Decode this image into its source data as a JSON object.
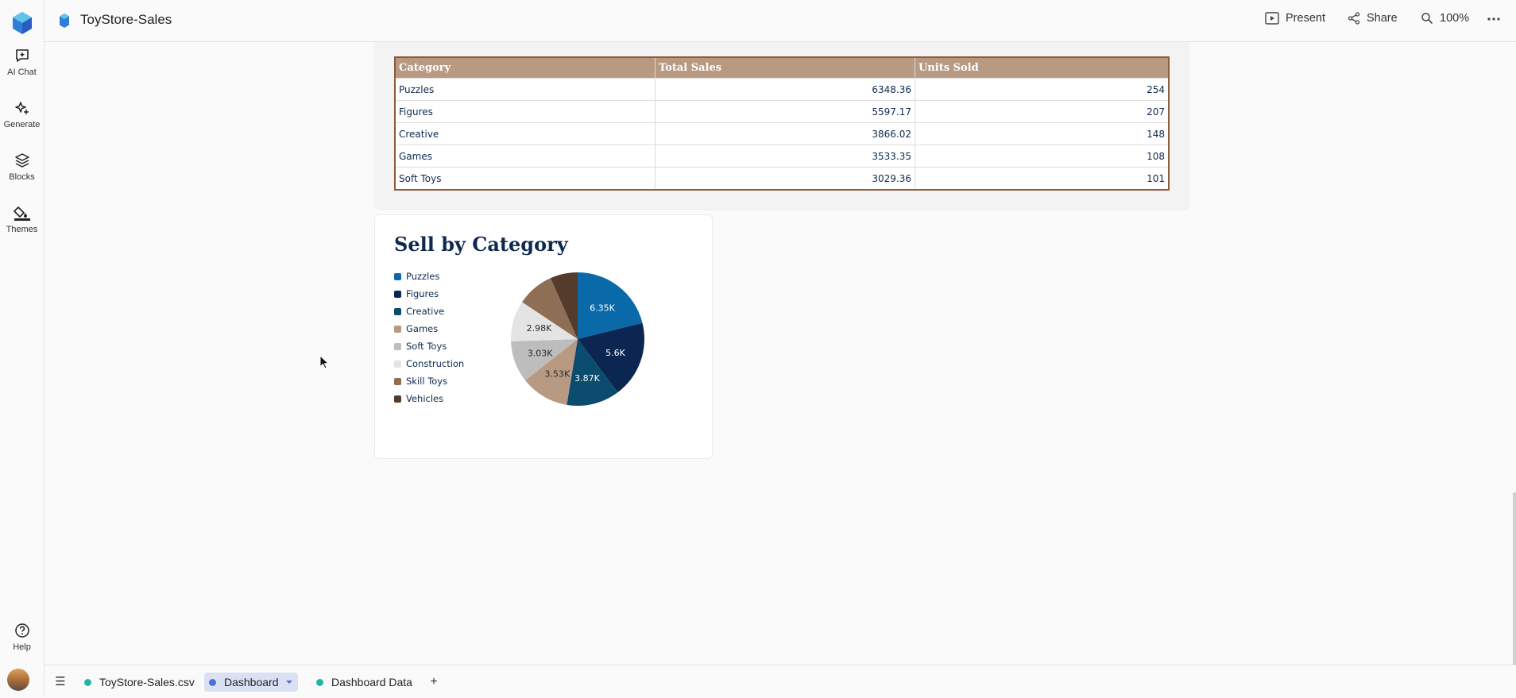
{
  "app": {
    "document_title": "ToyStore-Sales",
    "brand_color": "#3b8de0"
  },
  "rail": {
    "items": [
      {
        "label": "AI Chat",
        "icon": "ai-chat-icon"
      },
      {
        "label": "Generate",
        "icon": "sparkle-icon"
      },
      {
        "label": "Blocks",
        "icon": "blocks-icon"
      },
      {
        "label": "Themes",
        "icon": "paint-bucket-icon"
      }
    ],
    "help_label": "Help"
  },
  "header": {
    "present_label": "Present",
    "share_label": "Share",
    "zoom_label": "100%"
  },
  "table": {
    "headers": [
      "Category",
      "Total Sales",
      "Units Sold"
    ],
    "rows": [
      [
        "Puzzles",
        "6348.36",
        "254"
      ],
      [
        "Figures",
        "5597.17",
        "207"
      ],
      [
        "Creative",
        "3866.02",
        "148"
      ],
      [
        "Games",
        "3533.35",
        "108"
      ],
      [
        "Soft Toys",
        "3029.36",
        "101"
      ]
    ]
  },
  "chart_data": {
    "type": "pie",
    "title": "Sell by Category",
    "legend_position": "left",
    "slices": [
      {
        "label": "Puzzles",
        "value": 6348.36,
        "display": "6.35K",
        "color": "#0a6aa9",
        "label_color": "#ffffff"
      },
      {
        "label": "Figures",
        "value": 5597.17,
        "display": "5.6K",
        "color": "#0b2650",
        "label_color": "#ffffff"
      },
      {
        "label": "Creative",
        "value": 3866.02,
        "display": "3.87K",
        "color": "#0b4c6e",
        "label_color": "#ffffff"
      },
      {
        "label": "Games",
        "value": 3533.35,
        "display": "3.53K",
        "color": "#b89a83",
        "label_color": "#2a2a2a"
      },
      {
        "label": "Soft Toys",
        "value": 3029.36,
        "display": "3.03K",
        "color": "#bdbdbd",
        "label_color": "#2a2a2a"
      },
      {
        "label": "Construction",
        "value": 2980,
        "display": "2.98K",
        "color": "#e4e4e4",
        "label_color": "#2a2a2a"
      },
      {
        "label": "Skill Toys",
        "value": 2700,
        "display": "",
        "color": "#8e6e55",
        "label_color": "#ffffff"
      },
      {
        "label": "Vehicles",
        "value": 2000,
        "display": "",
        "color": "#553b2b",
        "label_color": "#ffffff"
      }
    ]
  },
  "tabs": [
    {
      "label": "ToyStore-Sales.csv",
      "dot_color": "#1fb8a6",
      "active": false
    },
    {
      "label": "Dashboard",
      "dot_color": "#4a6fe0",
      "active": true
    },
    {
      "label": "Dashboard Data",
      "dot_color": "#1fb8a6",
      "active": false
    }
  ],
  "add_tab_label": "+"
}
